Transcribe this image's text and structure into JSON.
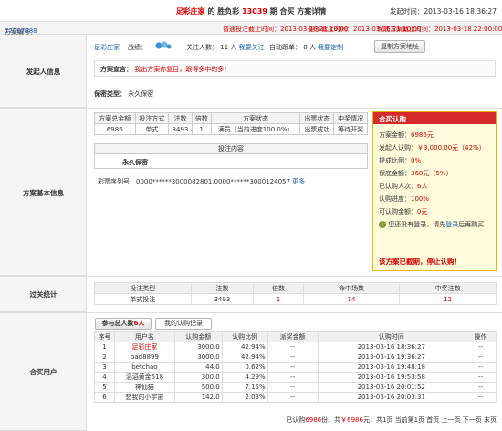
{
  "header": {
    "title_parts": [
      "足彩庄家",
      "的",
      "胜负彩",
      "13039",
      "期",
      "合买",
      "方案详情"
    ],
    "publish_label": "发起时间：",
    "publish_time": "2013-03-16 18:36:27"
  },
  "bar": {
    "plan_no_label": "方案编号：",
    "plan_no": "17007488",
    "normal_deadline": "普通投注截止时间：2013-03-16 21:10:00",
    "more_deadline": "更多截止时间：2013-03-16 21:10:00",
    "fill_deadline": "保底方案截止时间：2013-03-18 22:00:00"
  },
  "sections": {
    "initiator": "发起人信息",
    "basic": "方案基本信息",
    "pass": "过关统计",
    "users": "合买用户"
  },
  "initiator": {
    "name": "足彩庄家",
    "record_label": "战绩：",
    "follow_label": "关注人数：",
    "follow_count": "11",
    "follow_unit": "人",
    "follow_link": "我要关注",
    "auto_label": "自动跟单：",
    "auto_count": "8",
    "auto_unit": "人",
    "auto_link": "我要定制",
    "copy_button": "复制方案地址",
    "declaration_label": "方案宣言：",
    "declaration": "我出方案你复目，跟得多中的多！",
    "secrecy_label": "保密类型：",
    "secrecy": "永久保密"
  },
  "basic_table": {
    "headers": [
      "方案总金额",
      "投注方式",
      "注数",
      "倍数",
      "方案状态",
      "出票状态",
      "中奖情况"
    ],
    "row": [
      "6986",
      "单式",
      "3493",
      "1",
      "满员（当前进度100.0%）",
      "出票成功",
      "等待开奖"
    ]
  },
  "bet_content": {
    "header": "投注内容",
    "secret": "永久保密",
    "serial_label": "彩票序列号：",
    "serial": "0000******3000082801.0000******3000124057",
    "more": "更多"
  },
  "subscribe": {
    "header": "合买认购",
    "total_label": "方案金额：",
    "total": "6986元",
    "init_label": "发起人认购：",
    "init_value": "￥3,000.00元（42%）",
    "commission_label": "提成比例：",
    "commission": "0%",
    "guarantee_label": "保底金额：",
    "guarantee": "368元（5%）",
    "buyers_label": "已认购人次：",
    "buyers": "6人",
    "progress_label": "认购进度：",
    "progress": "100%",
    "available_label": "可认购金额：",
    "available": "0元",
    "login_hint": "您还没有登录，请先",
    "login_link": "登录",
    "login_tail": "后再购买",
    "closed": "该方案已截期，停止认购！"
  },
  "pass_table": {
    "headers": [
      "投注类型",
      "注数",
      "倍数",
      "命中场数",
      "中奖注数"
    ],
    "row": [
      "单式投注",
      "3493",
      "1",
      "14",
      "12"
    ]
  },
  "users_tabs": {
    "tab1_prefix": "参与总人数",
    "tab1_count": "6人",
    "tab2": "我的认购记录"
  },
  "users_table": {
    "headers": [
      "序号",
      "用户名",
      "认购金额",
      "认购比例",
      "派奖金额",
      "认购时间",
      "操作"
    ],
    "rows": [
      [
        "1",
        "足彩庄家",
        "3000.0",
        "42.94%",
        "--",
        "2013-03-16 18:36:27",
        "--"
      ],
      [
        "2",
        "bad8899",
        "3000.0",
        "42.94%",
        "--",
        "2013-03-16 19:36:27",
        "--"
      ],
      [
        "3",
        "betchao",
        "44.0",
        "0.62%",
        "--",
        "2013-03-16 19:48:18",
        "--"
      ],
      [
        "4",
        "滔滔黄金518",
        "300.0",
        "4.29%",
        "--",
        "2013-03-16 19:53:58",
        "--"
      ],
      [
        "5",
        "神仙猫",
        "500.0",
        "7.15%",
        "--",
        "2013-03-16 20:01:52",
        "--"
      ],
      [
        "6",
        "愁我的小宇宙",
        "142.0",
        "2.03%",
        "--",
        "2013-03-16 20:03:31",
        "--"
      ]
    ]
  },
  "pager": {
    "text1": "已认购",
    "count": "6986",
    "text2": "份，共",
    "amount": "￥6986",
    "text3": "元，共1页  当前第1页  首页  上一页  下一页  末页"
  },
  "colors": {
    "accent_red": "#d40000",
    "link_blue": "#1a5fb4",
    "subscribe_header": "#d42a2a",
    "subscribe_bg": "#fffbdb"
  }
}
